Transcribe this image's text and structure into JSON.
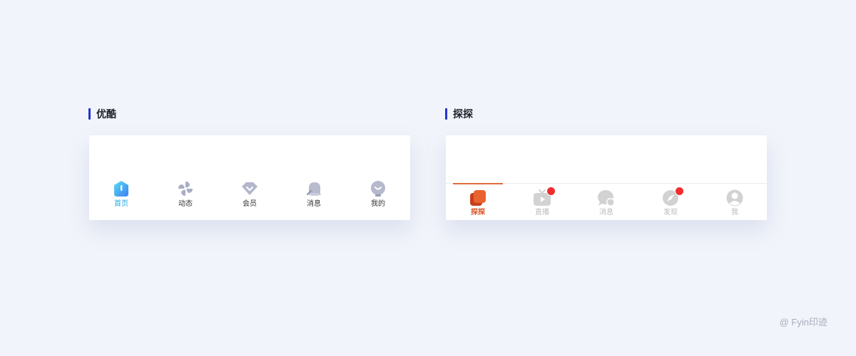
{
  "sections": {
    "youku": {
      "title": "优酷",
      "accent": "#2233cc",
      "active_color": "#23a9e6",
      "tabs": [
        {
          "label": "首页",
          "icon": "home-icon",
          "active": true
        },
        {
          "label": "动态",
          "icon": "pinwheel-icon",
          "active": false
        },
        {
          "label": "会员",
          "icon": "diamond-icon",
          "active": false
        },
        {
          "label": "消息",
          "icon": "bell-icon",
          "active": false
        },
        {
          "label": "我的",
          "icon": "profile-icon",
          "active": false
        }
      ]
    },
    "tantan": {
      "title": "探探",
      "accent": "#2233cc",
      "active_color": "#d9552a",
      "badge_color": "#f02d2d",
      "tabs": [
        {
          "label": "探探",
          "icon": "cards-icon",
          "active": true,
          "badge": false
        },
        {
          "label": "直播",
          "icon": "live-video-icon",
          "active": false,
          "badge": true
        },
        {
          "label": "消息",
          "icon": "chat-bubble-icon",
          "active": false,
          "badge": false
        },
        {
          "label": "发现",
          "icon": "compass-icon",
          "active": false,
          "badge": true
        },
        {
          "label": "我",
          "icon": "user-icon",
          "active": false,
          "badge": false
        }
      ]
    }
  },
  "watermark": "@ Fyin印迹"
}
